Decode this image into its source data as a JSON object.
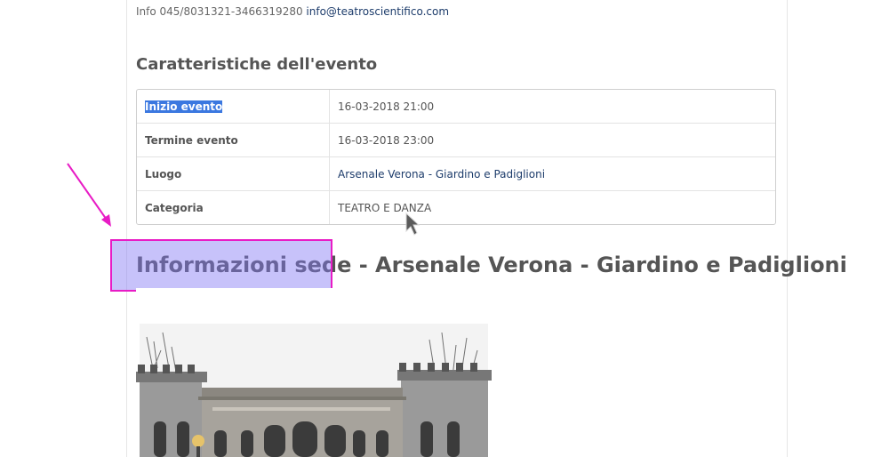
{
  "contact": {
    "info_text": "Info 045/8031321-3466319280",
    "email": "info@teatroscientifico.com"
  },
  "event_section": {
    "title": "Caratteristiche dell'evento",
    "rows": [
      {
        "label": "Inizio evento",
        "value": "16-03-2018 21:00"
      },
      {
        "label": "Termine evento",
        "value": "16-03-2018 23:00"
      },
      {
        "label": "Luogo",
        "value": "Arsenale Verona - Giardino e Padiglioni"
      },
      {
        "label": "Categoria",
        "value": "TEATRO E DANZA"
      }
    ]
  },
  "venue": {
    "heading": "Informazioni sede - Arsenale Verona - Giardino e Padiglioni",
    "image_icon": "building-photo"
  },
  "annotation": {
    "arrow_icon": "pointer-arrow",
    "highlight_color": "#e81cc5"
  },
  "colors": {
    "selection": "#3b78e0",
    "link": "#1d3c6b"
  }
}
